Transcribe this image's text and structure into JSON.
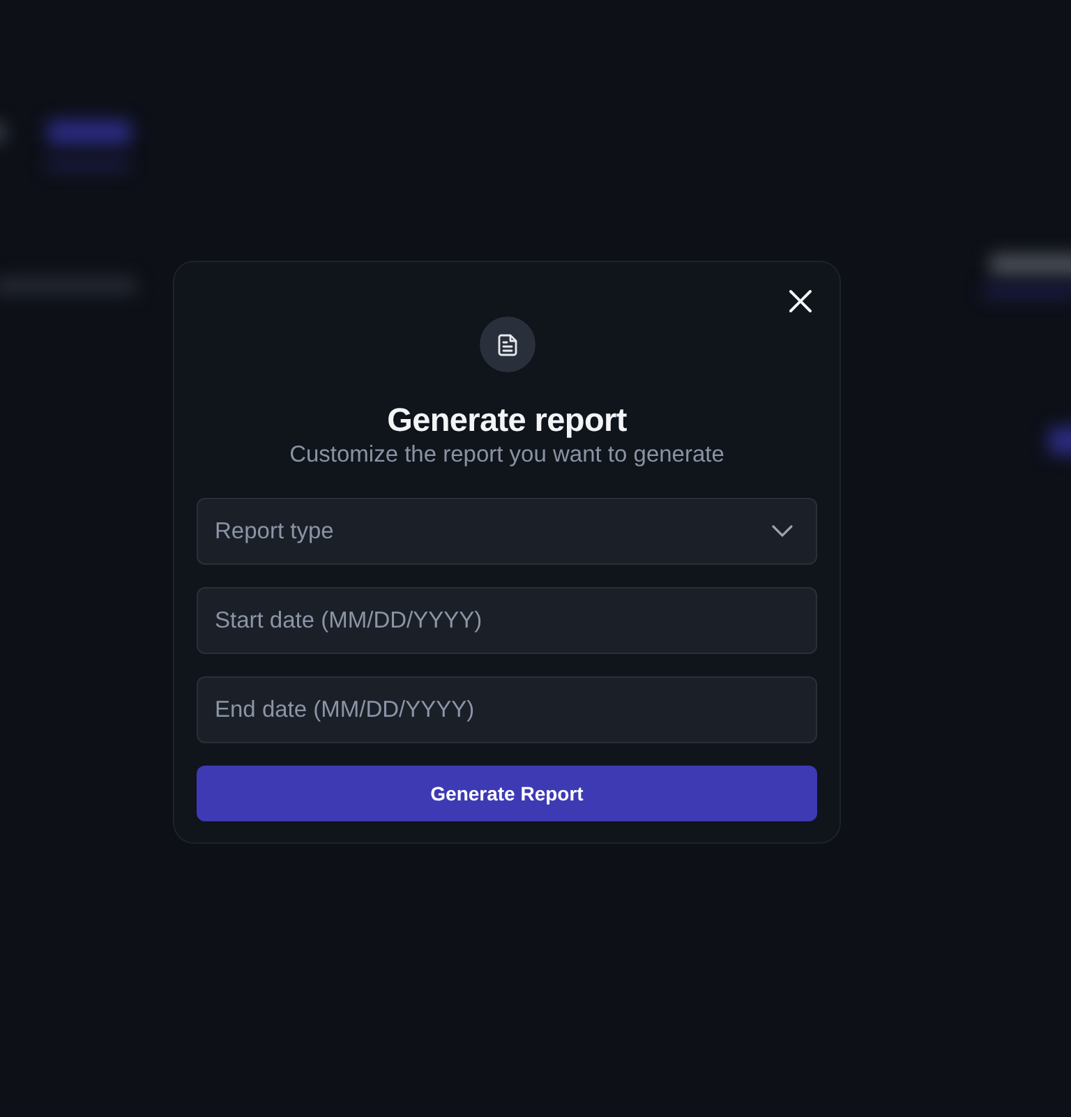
{
  "backdrop": {
    "blurred": true
  },
  "dialog": {
    "title": "Generate report",
    "subtitle": "Customize the report you want to generate",
    "fields": [
      {
        "kind": "select",
        "placeholder": "Report type"
      },
      {
        "kind": "text",
        "placeholder": "Start date (MM/DD/YYYY)"
      },
      {
        "kind": "text",
        "placeholder": "End date (MM/DD/YYYY)"
      }
    ],
    "submit": {
      "label": "Generate Report"
    }
  }
}
